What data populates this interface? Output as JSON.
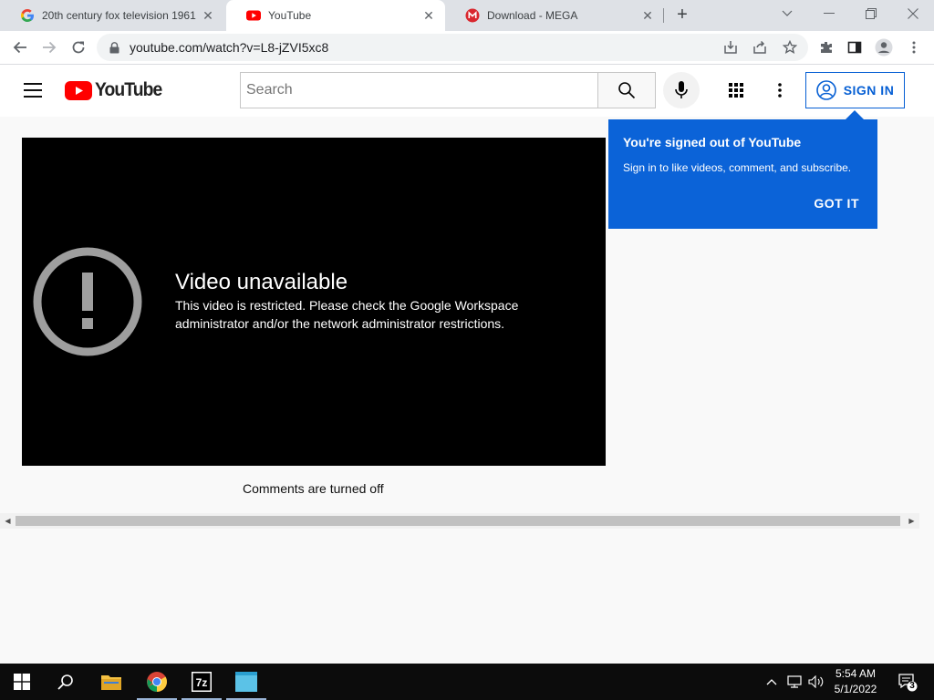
{
  "browser": {
    "tabs": [
      {
        "title": "20th century fox television 1961",
        "favicon": "google-icon"
      },
      {
        "title": "YouTube",
        "favicon": "youtube-icon"
      },
      {
        "title": "Download - MEGA",
        "favicon": "mega-icon"
      }
    ],
    "url": "youtube.com/watch?v=L8-jZVI5xc8"
  },
  "youtube": {
    "logo_text": "YouTube",
    "search_placeholder": "Search",
    "sign_in_label": "SIGN IN"
  },
  "player": {
    "error_title": "Video unavailable",
    "error_message": "This video is restricted. Please check the Google Workspace administrator and/or the network administrator restrictions."
  },
  "comments_text": "Comments are turned off",
  "tooltip": {
    "title": "You're signed out of YouTube",
    "description": "Sign in to like videos, comment, and subscribe.",
    "dismiss_label": "GOT IT"
  },
  "taskbar": {
    "time": "5:54 AM",
    "date": "5/1/2022",
    "notification_count": "3"
  },
  "colors": {
    "accent_blue": "#065fd4",
    "tooltip_blue": "#0b63d8",
    "youtube_red": "#ff0000"
  }
}
